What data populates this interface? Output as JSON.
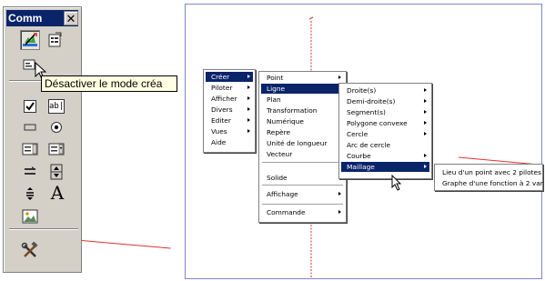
{
  "toolbox": {
    "title": "Comm",
    "close_label": "✕",
    "text_tool_glyph": "A",
    "textbox_glyph": "ab|"
  },
  "tooltip": {
    "text": "Désactiver le mode créa"
  },
  "menus": {
    "main": [
      {
        "label": "Créer",
        "selected": true,
        "submenu": true
      },
      {
        "label": "Piloter",
        "submenu": true
      },
      {
        "label": "Afficher",
        "submenu": true
      },
      {
        "label": "Divers",
        "submenu": true
      },
      {
        "label": "Editer",
        "submenu": true
      },
      {
        "label": "Vues",
        "submenu": true
      },
      {
        "label": "Aide",
        "submenu": false
      }
    ],
    "creer": [
      {
        "label": "Point",
        "submenu": true
      },
      {
        "label": "Ligne",
        "selected": true,
        "submenu": true
      },
      {
        "label": "Plan",
        "submenu": true
      },
      {
        "label": "Transformation",
        "submenu": true
      },
      {
        "label": "Numérique",
        "submenu": true
      },
      {
        "label": "Repère",
        "submenu": true
      },
      {
        "label": "Unité de longueur",
        "submenu": false
      },
      {
        "label": "Vecteur",
        "submenu": true
      },
      {
        "label": "Solide",
        "submenu": true
      },
      {
        "label": "Affichage",
        "submenu": true
      },
      {
        "label": "Commande",
        "submenu": true
      }
    ],
    "ligne": [
      {
        "label": "Droite(s)",
        "submenu": true
      },
      {
        "label": "Demi-droite(s)",
        "submenu": true
      },
      {
        "label": "Segment(s)",
        "submenu": true
      },
      {
        "label": "Polygone convexe",
        "submenu": true
      },
      {
        "label": "Cercle",
        "submenu": true
      },
      {
        "label": "Arc de cercle",
        "submenu": false
      },
      {
        "label": "Courbe",
        "submenu": true
      },
      {
        "label": "Maillage",
        "selected": true,
        "submenu": true
      }
    ],
    "maillage": [
      {
        "label": "Lieu d'un point avec 2 pilotes"
      },
      {
        "label": "Graphe d'une fonction à 2 var"
      }
    ]
  },
  "colors": {
    "menu_highlight": "#0a246a",
    "axis_red": "#e0302f",
    "frame_blue": "#7f88c8",
    "tooltip_bg": "#ffffe1"
  }
}
